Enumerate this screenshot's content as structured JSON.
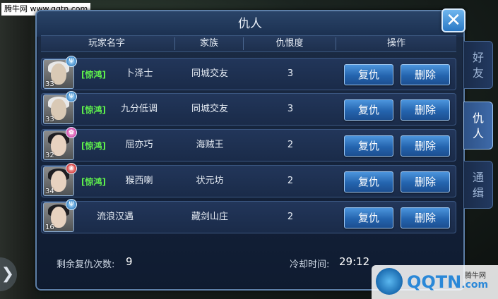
{
  "watermark_top": "腾牛网 www.qqtn.com",
  "panel": {
    "title": "仇人"
  },
  "columns": [
    "玩家名字",
    "家族",
    "仇恨度",
    "操作"
  ],
  "rows": [
    {
      "level": "33",
      "faction": "[惊鸿]",
      "name": "卜泽士",
      "family": "同城交友",
      "hatred": "3",
      "avatar": "silver-hair"
    },
    {
      "level": "33",
      "faction": "[惊鸿]",
      "name": "九分低调",
      "family": "同城交友",
      "hatred": "3",
      "avatar": "silver-hair"
    },
    {
      "level": "32",
      "faction": "[惊鸿]",
      "name": "屈亦巧",
      "family": "海贼王",
      "hatred": "2",
      "avatar": "dark-hair-female"
    },
    {
      "level": "34",
      "faction": "[惊鸿]",
      "name": "猴西喇",
      "family": "状元坊",
      "hatred": "2",
      "avatar": "dark-hair-female"
    },
    {
      "level": "16",
      "faction": "",
      "name": "流浪汉遇",
      "family": "藏剑山庄",
      "hatred": "2",
      "avatar": "dark-hair-male"
    }
  ],
  "buttons": {
    "revenge": "复仇",
    "delete": "删除"
  },
  "footer": {
    "remaining_label": "剩余复仇次数:",
    "remaining_value": "9",
    "cooldown_label": "冷却时间:",
    "cooldown_value": "29:12"
  },
  "tabs": [
    {
      "label_1": "好",
      "label_2": "友",
      "active": false
    },
    {
      "label_1": "仇",
      "label_2": "人",
      "active": true
    },
    {
      "label_1": "通",
      "label_2": "缉",
      "active": false
    }
  ],
  "logo": {
    "text": "QQTN",
    "suffix": ".com",
    "small": "腾牛网"
  },
  "colors": {
    "faction_green": "#5ff24c",
    "button_blue": "#2464ae",
    "panel_bg": "#14223a"
  }
}
